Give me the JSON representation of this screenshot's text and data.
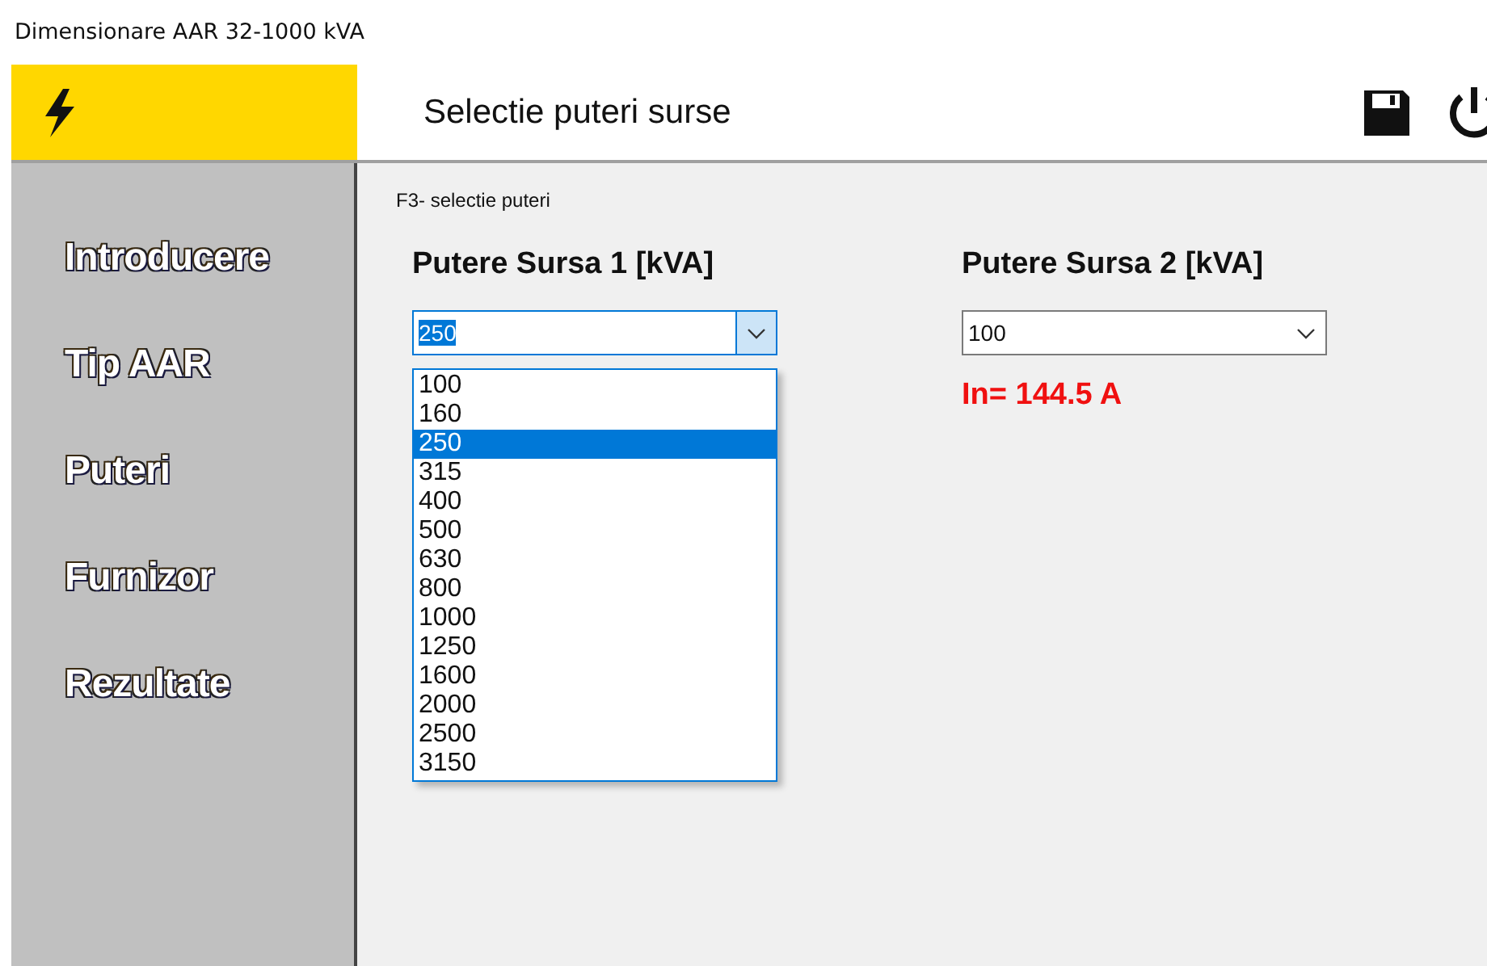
{
  "window": {
    "title": "Dimensionare AAR 32-1000 kVA"
  },
  "header": {
    "title": "Selectie puteri surse"
  },
  "sidebar": {
    "items": [
      {
        "label": "Introducere"
      },
      {
        "label": "Tip AAR"
      },
      {
        "label": "Puteri"
      },
      {
        "label": "Furnizor"
      },
      {
        "label": "Rezultate"
      }
    ]
  },
  "panel": {
    "caption": "F3- selectie puteri",
    "sources": [
      {
        "label": "Putere Sursa 1 [kVA]",
        "value": "250",
        "focused": true,
        "options": [
          {
            "label": "100",
            "selected": false
          },
          {
            "label": "160",
            "selected": false
          },
          {
            "label": "250",
            "selected": true
          },
          {
            "label": "315",
            "selected": false
          },
          {
            "label": "400",
            "selected": false
          },
          {
            "label": "500",
            "selected": false
          },
          {
            "label": "630",
            "selected": false
          },
          {
            "label": "800",
            "selected": false
          },
          {
            "label": "1000",
            "selected": false
          },
          {
            "label": "1250",
            "selected": false
          },
          {
            "label": "1600",
            "selected": false
          },
          {
            "label": "2000",
            "selected": false
          },
          {
            "label": "2500",
            "selected": false
          },
          {
            "label": "3150",
            "selected": false
          }
        ]
      },
      {
        "label": "Putere Sursa 2 [kVA]",
        "value": "100",
        "focused": false
      }
    ],
    "result": "In= 144.5 A"
  }
}
